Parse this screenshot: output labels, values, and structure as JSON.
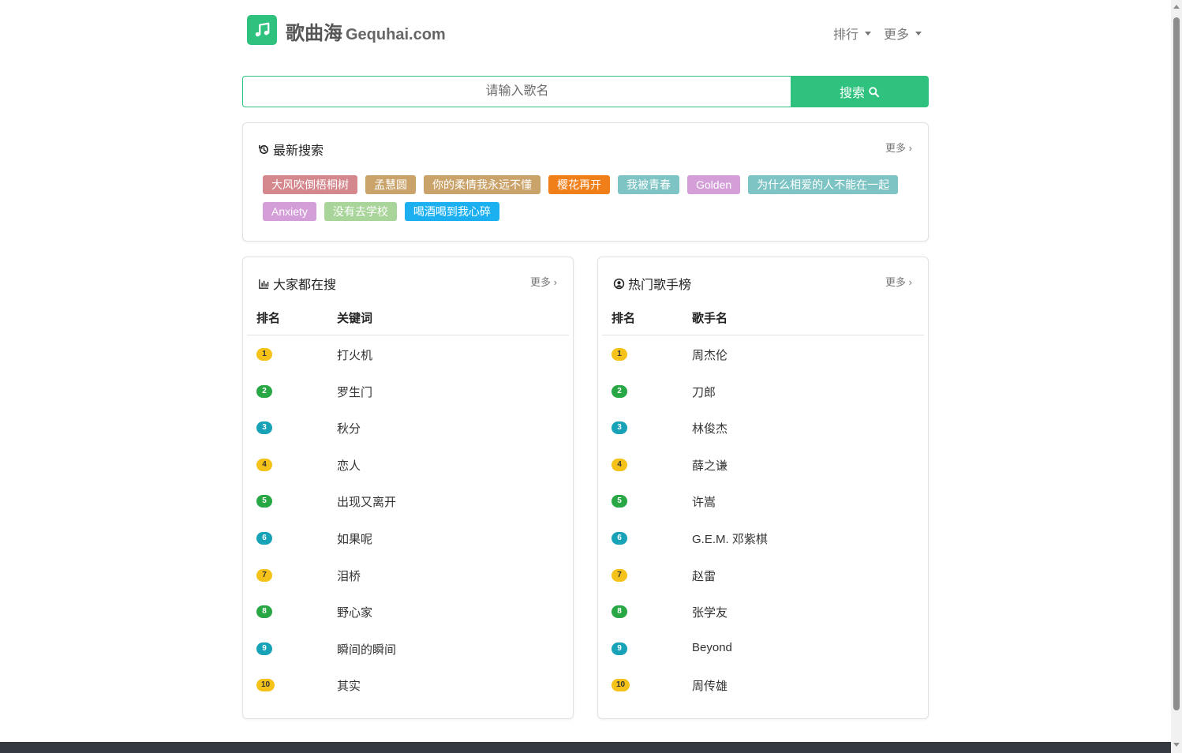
{
  "header": {
    "site_name": "歌曲海",
    "site_domain": "Gequhai.com",
    "nav": [
      {
        "label": "排行"
      },
      {
        "label": "更多"
      }
    ]
  },
  "search": {
    "placeholder": "请输入歌名",
    "button_label": "搜索"
  },
  "recent": {
    "title": "最新搜索",
    "more": "更多 ›",
    "tags": [
      {
        "label": "大风吹倒梧桐树",
        "color": "#d4888e"
      },
      {
        "label": "孟慧圆",
        "color": "#c9a36a"
      },
      {
        "label": "你的柔情我永远不懂",
        "color": "#c9a36a"
      },
      {
        "label": "樱花再开",
        "color": "#f07f1a"
      },
      {
        "label": "我被青春",
        "color": "#7ec4c4"
      },
      {
        "label": "Golden",
        "color": "#d49ed8"
      },
      {
        "label": "为什么相爱的人不能在一起",
        "color": "#7ec4c4"
      },
      {
        "label": "Anxiety",
        "color": "#d49ed8"
      },
      {
        "label": "没有去学校",
        "color": "#a9d49a"
      },
      {
        "label": "喝酒喝到我心碎",
        "color": "#1cb0f0"
      }
    ]
  },
  "popular": {
    "title": "大家都在搜",
    "more": "更多 ›",
    "col_rank": "排名",
    "col_key": "关键词",
    "rows": [
      {
        "rank": "1",
        "text": "打火机"
      },
      {
        "rank": "2",
        "text": "罗生门"
      },
      {
        "rank": "3",
        "text": "秋分"
      },
      {
        "rank": "4",
        "text": "恋人"
      },
      {
        "rank": "5",
        "text": "出现又离开"
      },
      {
        "rank": "6",
        "text": "如果呢"
      },
      {
        "rank": "7",
        "text": "泪桥"
      },
      {
        "rank": "8",
        "text": "野心家"
      },
      {
        "rank": "9",
        "text": "瞬间的瞬间"
      },
      {
        "rank": "10",
        "text": "其实"
      }
    ]
  },
  "singers": {
    "title": "热门歌手榜",
    "more": "更多 ›",
    "col_rank": "排名",
    "col_key": "歌手名",
    "rows": [
      {
        "rank": "1",
        "text": "周杰伦"
      },
      {
        "rank": "2",
        "text": "刀郎"
      },
      {
        "rank": "3",
        "text": "林俊杰"
      },
      {
        "rank": "4",
        "text": "薛之谦"
      },
      {
        "rank": "5",
        "text": "许嵩"
      },
      {
        "rank": "6",
        "text": "G.E.M. 邓紫棋"
      },
      {
        "rank": "7",
        "text": "赵雷"
      },
      {
        "rank": "8",
        "text": "张学友"
      },
      {
        "rank": "9",
        "text": "Beyond"
      },
      {
        "rank": "10",
        "text": "周传雄"
      }
    ]
  },
  "badge_colors": [
    "#f5c21a",
    "#28a745",
    "#17a2b8"
  ],
  "icons": {
    "logo": "music-note-icon",
    "search": "search-icon",
    "recent": "history-icon",
    "popular": "bar-chart-icon",
    "singers": "user-circle-icon"
  }
}
